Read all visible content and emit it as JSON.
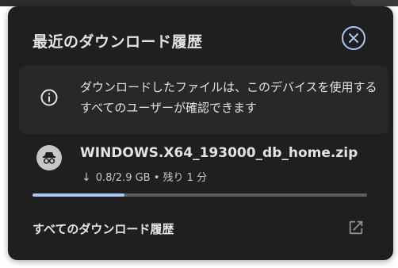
{
  "panel": {
    "title": "最近のダウンロード履歴"
  },
  "notice": {
    "text": "ダウンロードしたファイルは、このデバイスを使用するすべてのユーザーが確認できます"
  },
  "download": {
    "filename": "WINDOWS.X64_193000_db_home.zip",
    "arrow": "↓",
    "status": "0.8/2.9 GB • 残り 1 分",
    "progress_fraction": 0.276
  },
  "footer": {
    "all_history_label": "すべてのダウンロード履歴"
  },
  "icons": {
    "close": "close-icon",
    "info": "info-icon",
    "incognito": "incognito-icon",
    "external": "open-in-new-icon"
  },
  "colors": {
    "background": "#1f1f1f",
    "accent": "#a8c7fa",
    "notice_bg": "#282828",
    "text": "#e3e3e3"
  }
}
